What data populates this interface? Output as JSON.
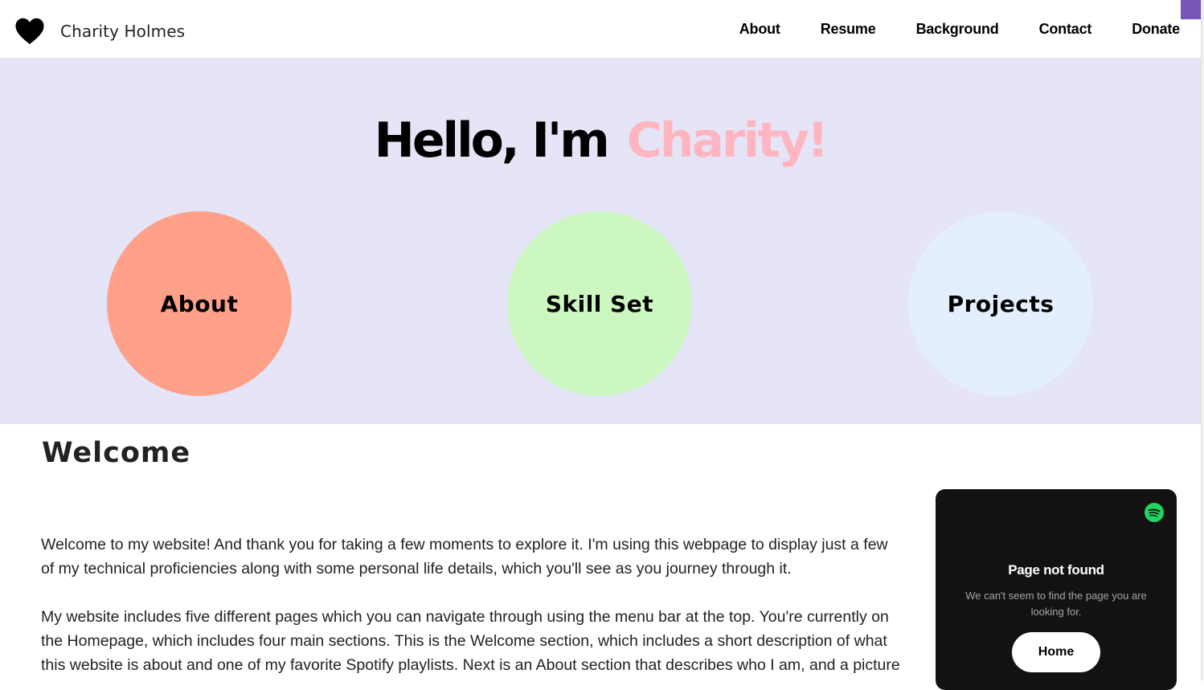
{
  "colors": {
    "hero_bg": "#e5e5f7",
    "accent_name": "#ffb6c1",
    "about_circle": "#ffa088",
    "skills_circle": "#ccf7c1",
    "projects_circle": "#e3efff",
    "corner_badge": "#7a55b8",
    "spotify_green": "#1ed760"
  },
  "header": {
    "logo_icon": "heart-icon",
    "brand_name": "Charity Holmes",
    "nav": [
      {
        "label": "About"
      },
      {
        "label": "Resume"
      },
      {
        "label": "Background"
      },
      {
        "label": "Contact"
      },
      {
        "label": "Donate"
      }
    ]
  },
  "hero": {
    "greeting": "Hello, I'm",
    "name": "Charity!",
    "circles": [
      {
        "label": "About"
      },
      {
        "label": "Skill Set"
      },
      {
        "label": "Projects"
      }
    ]
  },
  "welcome": {
    "title": "Welcome",
    "paragraphs": [
      "Welcome to my website! And thank you for taking a few moments to explore it. I'm using this webpage to display just a few of my technical proficiencies along with some personal life details, which you'll see as you journey through it.",
      "My website includes five different pages which you can navigate through using the menu bar at the top. You're currently on the Homepage, which includes four main sections. This is the Welcome section, which includes a short description of what this website is about and one of my favorite Spotify playlists. Next is an About section that describes who I am, and a picture"
    ]
  },
  "spotify_embed": {
    "icon": "spotify-icon",
    "title": "Page not found",
    "message": "We can't seem to find the page you are looking for.",
    "button_label": "Home"
  }
}
